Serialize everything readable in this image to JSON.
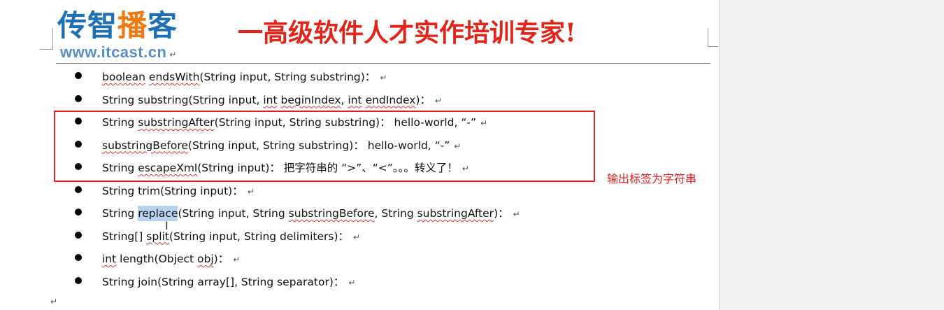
{
  "header": {
    "logo_part1": "传智",
    "logo_part2": "播",
    "logo_part3": "客",
    "website": "www.itcast.cn",
    "slogan": "一高级软件人才实作培训专家!"
  },
  "paragraph_mark": "↵",
  "items": [
    {
      "parts": [
        {
          "t": "boolean",
          "sq": true
        },
        {
          "t": " "
        },
        {
          "t": "endsWith",
          "sq": true
        },
        {
          "t": "(String  input, String substring)："
        }
      ]
    },
    {
      "parts": [
        {
          "t": "String substring(String  input, "
        },
        {
          "t": "int",
          "sq": true
        },
        {
          "t": " "
        },
        {
          "t": "beginIndex",
          "sq": true
        },
        {
          "t": ", "
        },
        {
          "t": "int",
          "sq": true
        },
        {
          "t": " "
        },
        {
          "t": "endIndex",
          "sq": true
        },
        {
          "t": ")："
        }
      ]
    },
    {
      "parts": [
        {
          "t": "String "
        },
        {
          "t": "substringAfter",
          "sq": true
        },
        {
          "t": "(String  input, String substring)：  hello-world,  “-”"
        }
      ]
    },
    {
      "parts": [
        {
          "t": "substringBefore",
          "sq": true
        },
        {
          "t": "(String  input, String substring)：  hello-world,  “-”"
        }
      ]
    },
    {
      "parts": [
        {
          "t": "String "
        },
        {
          "t": "escapeXml",
          "sq": true
        },
        {
          "t": "(String  input)：  把字符串的 “>”、“<”。。。转义了！"
        }
      ]
    },
    {
      "parts": [
        {
          "t": "String trim(String  input)："
        }
      ]
    },
    {
      "parts": [
        {
          "t": "String "
        },
        {
          "t": "replace",
          "hl": true
        },
        {
          "t": "(String  input, String "
        },
        {
          "t": "substringBefore",
          "sq": true
        },
        {
          "t": ", String "
        },
        {
          "t": "substringAfter",
          "sq": true
        },
        {
          "t": ")："
        }
      ]
    },
    {
      "parts": [
        {
          "t": "String[] "
        },
        {
          "t": "split",
          "sq": true
        },
        {
          "t": "(String  input, String delimiters)："
        }
      ]
    },
    {
      "parts": [
        {
          "t": "int",
          "sq": true
        },
        {
          "t": " length(Object "
        },
        {
          "t": "obj",
          "sq": true
        },
        {
          "t": ")："
        }
      ]
    },
    {
      "parts": [
        {
          "t": "String join(String array[], String separator)："
        }
      ]
    }
  ],
  "annotation": "输出标签为字符串",
  "colors": {
    "annotation_red": "#e02020",
    "logo_blue": "#1f6fb4",
    "logo_orange": "#f07a10",
    "selection": "#b8d3f0"
  }
}
